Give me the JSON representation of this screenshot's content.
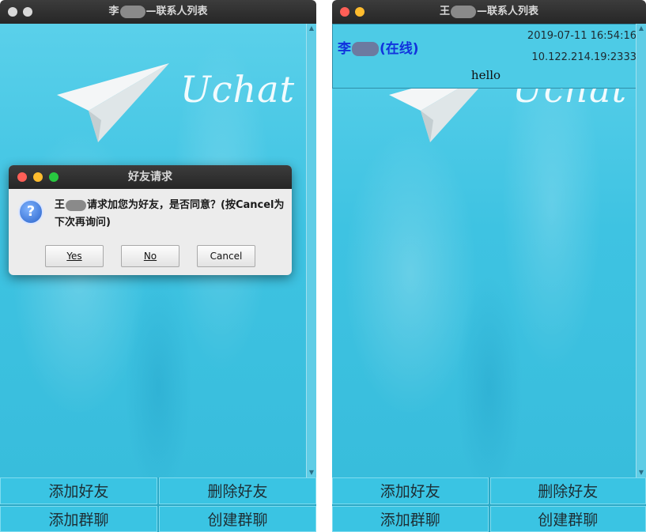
{
  "left_window": {
    "title_prefix": "李",
    "title_suffix": "—联系人列表",
    "logo_text": "Uchat",
    "dialog": {
      "title": "好友请求",
      "message_prefix": "王",
      "message_suffix": "请求加您为好友，是否同意？(按Cancel为下次再询问)",
      "yes_label": "Yes",
      "no_label": "No",
      "cancel_label": "Cancel"
    },
    "buttons": {
      "add_friend": "添加好友",
      "delete_friend": "删除好友",
      "add_group": "添加群聊",
      "create_group": "创建群聊"
    }
  },
  "right_window": {
    "title_prefix": "王",
    "title_suffix": "—联系人列表",
    "logo_text": "Uchat",
    "contact": {
      "name_prefix": "李",
      "status": "(在线)",
      "timestamp": "2019-07-11 16:54:16",
      "ip": "10.122.214.19:2333",
      "message": "hello"
    },
    "buttons": {
      "add_friend": "添加好友",
      "delete_friend": "删除好友",
      "add_group": "添加群聊",
      "create_group": "创建群聊"
    }
  },
  "colors": {
    "background_cyan": "#3ec3e2",
    "titlebar": "#2b2b2b",
    "close_red": "#ff5f57",
    "minimize_yellow": "#febc2e",
    "maximize_green": "#28c840",
    "sender_blue": "#1133dd"
  },
  "icons": [
    "paper-plane-icon",
    "question-icon",
    "scroll-up-icon",
    "scroll-down-icon"
  ]
}
